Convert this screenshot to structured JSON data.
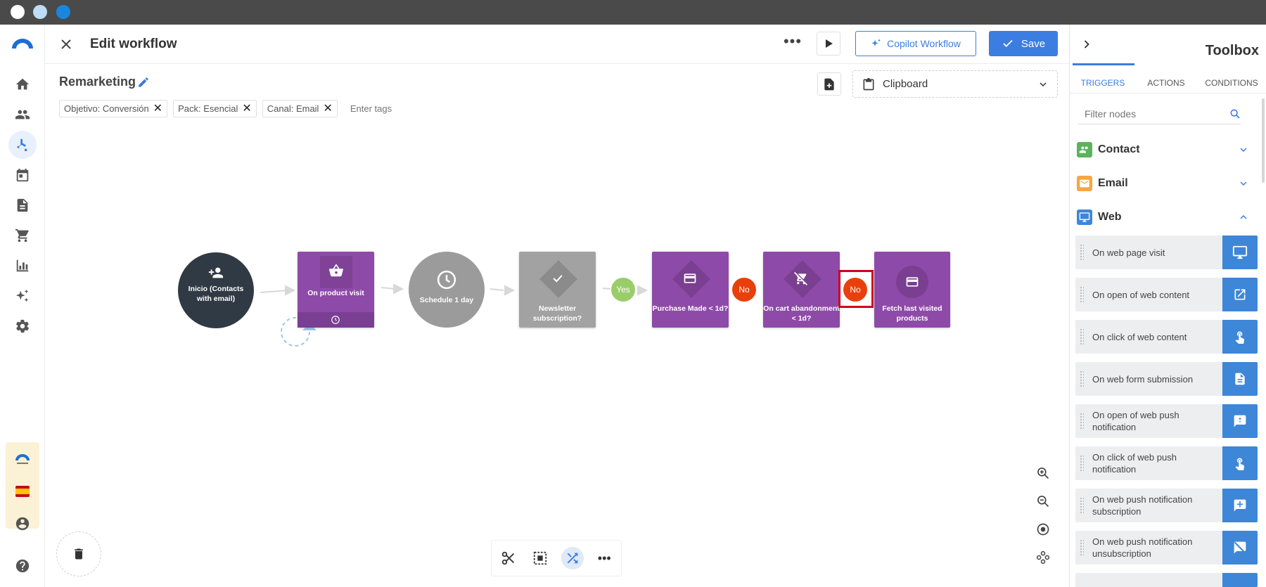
{
  "header": {
    "title": "Edit workflow",
    "copilot_label": "Copilot Workflow",
    "save_label": "Save"
  },
  "workflow": {
    "name": "Remarketing",
    "tags": [
      "Objetivo: Conversión",
      "Pack: Esencial",
      "Canal: Email"
    ],
    "tag_placeholder": "Enter tags",
    "clipboard_label": "Clipboard"
  },
  "nodes": {
    "start": "Inicio (Contacts with email)",
    "product_visit": "On product visit",
    "schedule": "Schedule 1 day",
    "newsletter": "Newsletter subscription?",
    "purchase": "Purchase Made < 1d?",
    "cart": "On cart abandonment < 1d?",
    "fetch": "Fetch last visited products"
  },
  "badges": {
    "yes": "Yes",
    "no1": "No",
    "no2": "No"
  },
  "colors": {
    "accent": "#3b7de0",
    "node_purple": "#8e4aa8",
    "node_dark": "#303a44",
    "node_gray": "#9b9b9b",
    "yes_green": "#9acd6a",
    "no_red": "#e8400c",
    "highlight": "#d0021b"
  },
  "toolbox": {
    "title": "Toolbox",
    "tabs": [
      "TRIGGERS",
      "ACTIONS",
      "CONDITIONS"
    ],
    "filter_placeholder": "Filter nodes",
    "sections": [
      "Contact",
      "Email",
      "Web"
    ],
    "items": [
      {
        "label": "On web page visit",
        "icon": "monitor-icon"
      },
      {
        "label": "On open of web content",
        "icon": "external-link-icon"
      },
      {
        "label": "On click of web content",
        "icon": "pointer-hand-icon"
      },
      {
        "label": "On web form submission",
        "icon": "document-icon"
      },
      {
        "label": "On open of web push notification",
        "icon": "message-alert-icon"
      },
      {
        "label": "On click of web push notification",
        "icon": "pointer-hand-icon"
      },
      {
        "label": "On web push notification subscription",
        "icon": "message-plus-icon"
      },
      {
        "label": "On web push notification unsubscription",
        "icon": "message-off-icon"
      }
    ]
  }
}
